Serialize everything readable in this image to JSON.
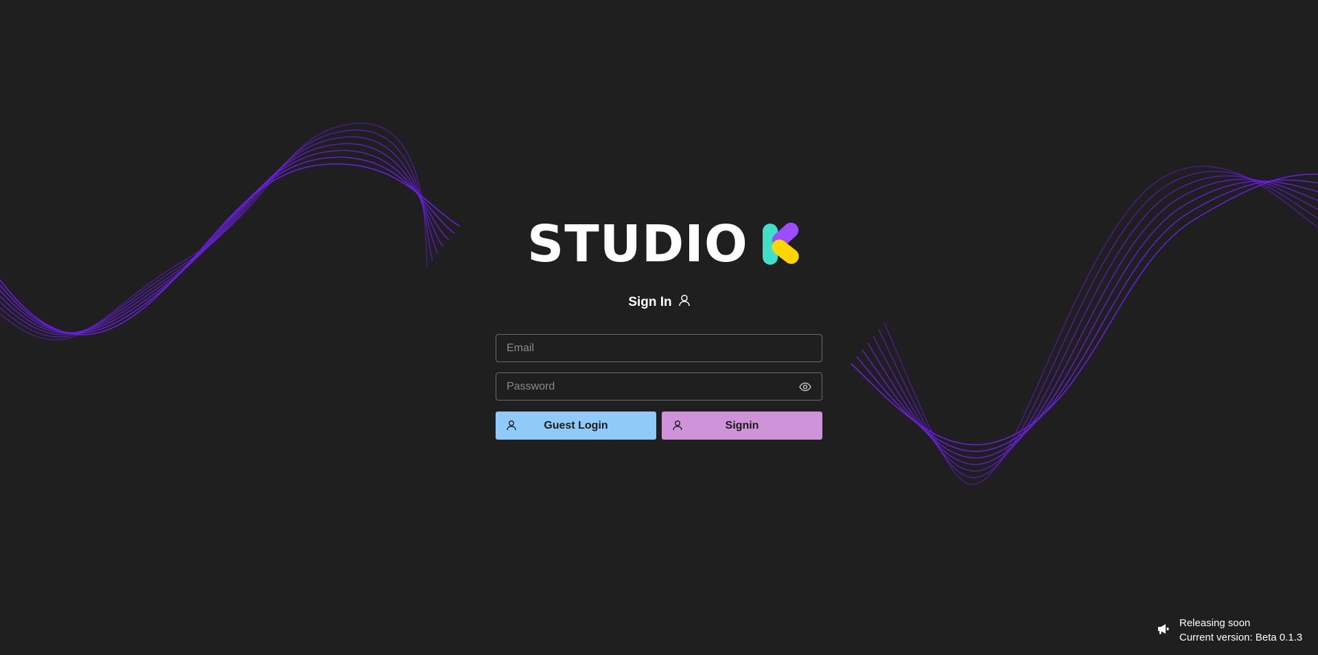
{
  "brand": {
    "logo_text": "STUDIO",
    "logo_icon": "k-logo-icon",
    "colors": {
      "teal": "#40e0c8",
      "purple": "#9b4dff",
      "yellow": "#ffd600"
    }
  },
  "login": {
    "heading": "Sign In",
    "heading_icon": "user-icon",
    "email_placeholder": "Email",
    "email_value": "",
    "password_placeholder": "Password",
    "password_value": "",
    "password_toggle_icon": "eye-icon",
    "guest_button_label": "Guest Login",
    "signin_button_label": "Signin",
    "colors": {
      "guest_button": "#90caf9",
      "signin_button": "#ce93d8"
    }
  },
  "release": {
    "icon": "megaphone-icon",
    "title": "Releasing soon",
    "version_text": "Current version: Beta 0.1.3"
  },
  "theme": {
    "background": "#1f1f1f",
    "wave_color": "#6a1fe0"
  }
}
